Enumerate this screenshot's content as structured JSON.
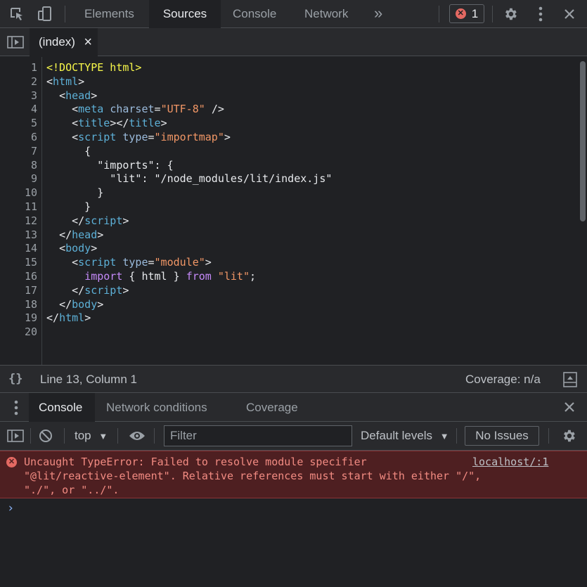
{
  "top_tabs": [
    {
      "label": "Elements"
    },
    {
      "label": "Sources"
    },
    {
      "label": "Console"
    },
    {
      "label": "Network"
    }
  ],
  "more_tabs_label": "»",
  "error_count": "1",
  "file_tab": {
    "label": "(index)",
    "close": "×"
  },
  "editor": {
    "line_numbers": [
      "1",
      "2",
      "3",
      "4",
      "5",
      "6",
      "7",
      "8",
      "9",
      "10",
      "11",
      "12",
      "13",
      "14",
      "15",
      "16",
      "17",
      "18",
      "19",
      "20"
    ]
  },
  "status": {
    "braces": "{}",
    "position": "Line 13, Column 1",
    "coverage": "Coverage: n/a"
  },
  "drawer_tabs": [
    {
      "label": "Console"
    },
    {
      "label": "Network conditions"
    },
    {
      "label": "Coverage"
    }
  ],
  "console_toolbar": {
    "context": "top",
    "filter_placeholder": "Filter",
    "levels": "Default levels",
    "issues": "No Issues"
  },
  "console_error": {
    "message": "Uncaught TypeError: Failed to resolve module specifier\n\"@lit/reactive-element\". Relative references must start with either \"/\",\n\"./\", or \"../\".",
    "source": "localhost/:1"
  },
  "prompt_symbol": "›",
  "colors": {
    "accent": "#8ab4f8",
    "error": "#e46962",
    "error_bg": "#4e1f21"
  }
}
